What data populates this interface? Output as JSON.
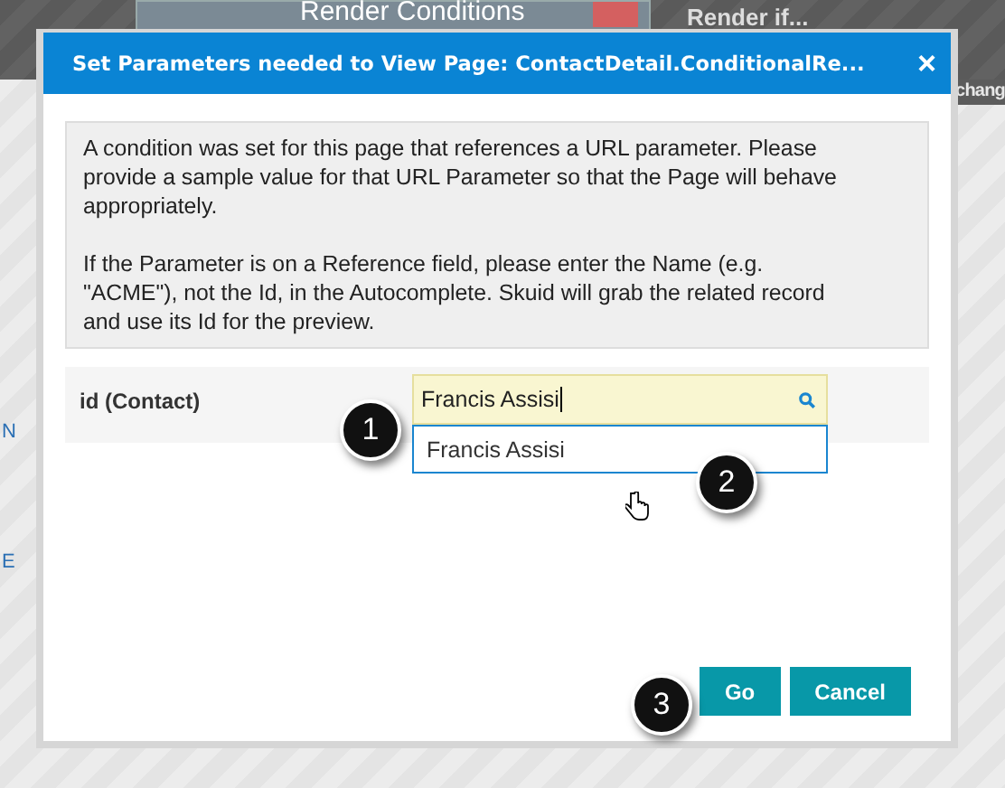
{
  "background": {
    "panel_title": "Render Conditions",
    "side_label": "Render if...",
    "side_text": "chang",
    "left_letters": [
      "N",
      "E"
    ]
  },
  "dialog": {
    "title": "Set Parameters needed to View Page: ContactDetail.ConditionalRe...",
    "close": "×",
    "info": [
      "A condition was set for this page that references a URL parameter. Please provide a sample value for that URL Parameter so that the Page will behave appropriately.",
      "If the Parameter is on a Reference field, please enter the Name (e.g. \"ACME\"), not the Id, in the Autocomplete. Skuid will grab the related record and use its Id for the preview."
    ],
    "field": {
      "label": "id (Contact)",
      "value": "Francis Assisi",
      "suggestions": [
        "Francis Assisi"
      ]
    },
    "buttons": [
      "Go",
      "Cancel"
    ]
  },
  "callouts": [
    "1",
    "2",
    "3"
  ]
}
